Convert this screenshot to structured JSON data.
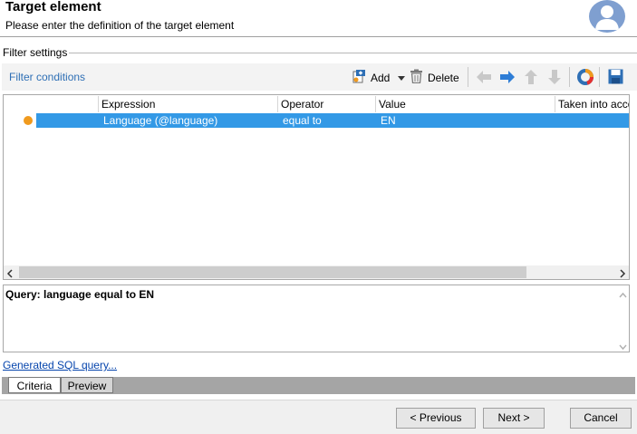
{
  "header": {
    "title": "Target element",
    "subtitle": "Please enter the definition of the target element"
  },
  "filter": {
    "group_label": "Filter settings",
    "toolbar_label": "Filter conditions",
    "add_label": "Add",
    "delete_label": "Delete"
  },
  "grid": {
    "columns": [
      "Expression",
      "Operator",
      "Value",
      "Taken into acco"
    ],
    "rows": [
      {
        "expression": "Language (@language)",
        "operator": "equal to",
        "value": "EN",
        "taken": ""
      }
    ]
  },
  "query": {
    "text": "Query: language equal to EN"
  },
  "sql_link": "Generated SQL query...",
  "tabs": [
    "Criteria",
    "Preview"
  ],
  "buttons": {
    "previous": "< Previous",
    "next": "Next >",
    "cancel": "Cancel"
  },
  "colors": {
    "selection": "#3399e6",
    "link": "#2e6fb5",
    "status_dot": "#f09a1e"
  }
}
